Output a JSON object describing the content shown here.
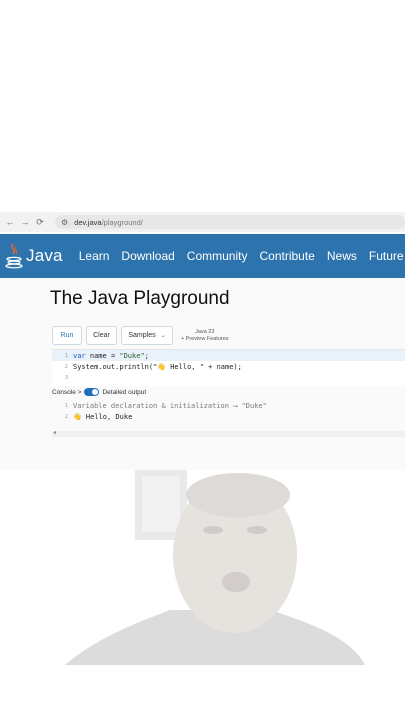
{
  "browser": {
    "back_icon": "back-arrow-icon",
    "forward_icon": "forward-arrow-icon",
    "reload_icon": "reload-icon",
    "url_domain": "dev.java",
    "url_path": "/playground/"
  },
  "nav": {
    "logo_text": "Java",
    "links": [
      "Learn",
      "Download",
      "Community",
      "Contribute",
      "News",
      "Future"
    ],
    "brand_color": "#2d73ad"
  },
  "page": {
    "title": "The Java Playground"
  },
  "toolbar": {
    "run_label": "Run",
    "clear_label": "Clear",
    "samples_label": "Samples",
    "version_line1": "Java 23",
    "version_line2": "+ Preview Features"
  },
  "editor": {
    "lines": [
      {
        "num": "1",
        "kw": "var",
        "rest": " name = ",
        "str": "\"Duke\"",
        "tail": ";"
      },
      {
        "num": "2",
        "text": "System.out.println(\"👋 Hello, \" + name);"
      },
      {
        "num": "3",
        "text": ""
      }
    ]
  },
  "console": {
    "label": "Console >",
    "toggle_label": "Detailed output",
    "toggle_on": true,
    "output": [
      {
        "num": "1",
        "text": "Variable declaration & initialization ⟶ \"Duke\""
      },
      {
        "num": "2",
        "text": "👋 Hello, Duke"
      }
    ]
  }
}
